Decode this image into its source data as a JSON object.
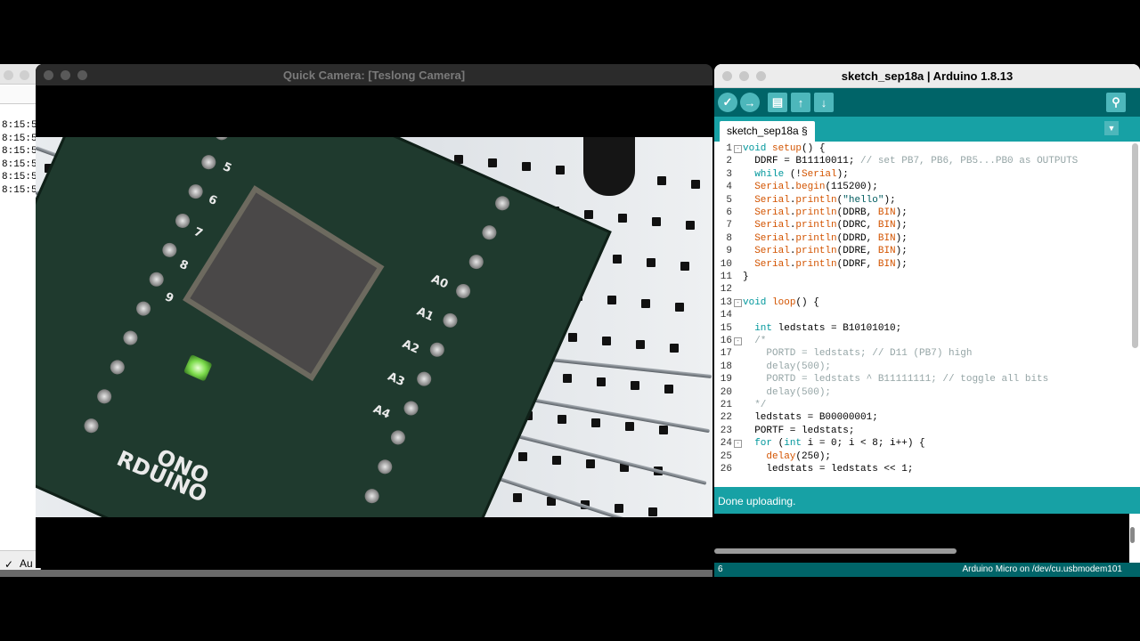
{
  "serial_monitor": {
    "lines": [
      "8:15:5",
      "8:15:5",
      "8:15:5",
      "8:15:5",
      "8:15:5",
      "8:15:5"
    ],
    "autoscroll_label": "Au",
    "autoscroll_checked": true
  },
  "camera": {
    "title": "Quick Camera: [Teslong Camera]",
    "board_labels": [
      "5",
      "6",
      "7",
      "8",
      "9",
      "A0",
      "A1",
      "A2",
      "A3",
      "A4",
      "ONO",
      "RDUINO"
    ]
  },
  "ide": {
    "title": "sketch_sep18a | Arduino 1.8.13",
    "toolbar": {
      "verify": "verify-icon",
      "upload": "upload-icon",
      "new": "new-icon",
      "open": "open-icon",
      "save": "save-icon",
      "serial": "serial-monitor-icon"
    },
    "tab_label": "sketch_sep18a §",
    "code_lines": [
      {
        "n": "1",
        "fold": "-",
        "text": "void setup() {"
      },
      {
        "n": "2",
        "fold": "",
        "text": "  DDRF = B11110011; // set PB7, PB6, PB5...PB0 as OUTPUTS"
      },
      {
        "n": "3",
        "fold": "",
        "text": "  while (!Serial);"
      },
      {
        "n": "4",
        "fold": "",
        "text": "  Serial.begin(115200);"
      },
      {
        "n": "5",
        "fold": "",
        "text": "  Serial.println(\"hello\");"
      },
      {
        "n": "6",
        "fold": "",
        "text": "  Serial.println(DDRB, BIN);"
      },
      {
        "n": "7",
        "fold": "",
        "text": "  Serial.println(DDRC, BIN);"
      },
      {
        "n": "8",
        "fold": "",
        "text": "  Serial.println(DDRD, BIN);"
      },
      {
        "n": "9",
        "fold": "",
        "text": "  Serial.println(DDRE, BIN);"
      },
      {
        "n": "10",
        "fold": "",
        "text": "  Serial.println(DDRF, BIN);"
      },
      {
        "n": "11",
        "fold": "",
        "text": "}"
      },
      {
        "n": "12",
        "fold": "",
        "text": ""
      },
      {
        "n": "13",
        "fold": "-",
        "text": "void loop() {"
      },
      {
        "n": "14",
        "fold": "",
        "text": ""
      },
      {
        "n": "15",
        "fold": "",
        "text": "  int ledstats = B10101010;"
      },
      {
        "n": "16",
        "fold": "-",
        "text": "  /*"
      },
      {
        "n": "17",
        "fold": "",
        "text": "    PORTD = ledstats; // D11 (PB7) high"
      },
      {
        "n": "18",
        "fold": "",
        "text": "    delay(500);"
      },
      {
        "n": "19",
        "fold": "",
        "text": "    PORTD = ledstats ^ B11111111; // toggle all bits"
      },
      {
        "n": "20",
        "fold": "",
        "text": "    delay(500);"
      },
      {
        "n": "21",
        "fold": "",
        "text": "  */"
      },
      {
        "n": "22",
        "fold": "",
        "text": "  ledstats = B00000001;"
      },
      {
        "n": "23",
        "fold": "",
        "text": "  PORTF = ledstats;"
      },
      {
        "n": "24",
        "fold": "-",
        "text": "  for (int i = 0; i < 8; i++) {"
      },
      {
        "n": "25",
        "fold": "",
        "text": "    delay(250);"
      },
      {
        "n": "26",
        "fold": "",
        "text": "    ledstats = ledstats << 1;"
      }
    ],
    "status_message": "Done uploading.",
    "footer_line": "6",
    "footer_board": "Arduino Micro on /dev/cu.usbmodem101",
    "colors": {
      "toolbar": "#006468",
      "tabbar": "#17a1a5",
      "keyword": "#00979c",
      "function": "#d35400",
      "comment": "#95a5a6",
      "string": "#005c5f"
    }
  }
}
